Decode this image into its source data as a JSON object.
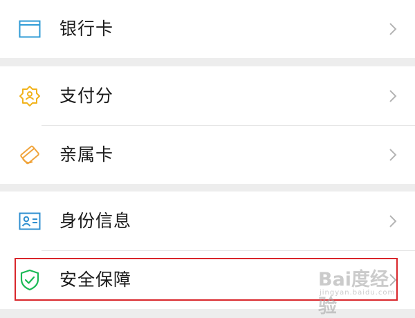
{
  "colors": {
    "background": "#ededed",
    "card": "#ffffff",
    "bank_card_icon": "#2f9bd6",
    "payscore_icon": "#f1b31c",
    "family_card_icon": "#f0a33a",
    "identity_icon": "#2f8fd0",
    "security_icon": "#19b955",
    "chevron": "#b5b5b5",
    "highlight_border": "#d9262b"
  },
  "menu": {
    "bank_card": {
      "label": "银行卡",
      "icon": "card-icon"
    },
    "payscore": {
      "label": "支付分",
      "icon": "payscore-badge-icon"
    },
    "family_card": {
      "label": "亲属卡",
      "icon": "family-card-icon"
    },
    "identity": {
      "label": "身份信息",
      "icon": "id-card-icon"
    },
    "security": {
      "label": "安全保障",
      "icon": "shield-check-icon"
    }
  },
  "watermark": {
    "text": "Bai度经验",
    "sub": "jingyan.baidu.com"
  }
}
